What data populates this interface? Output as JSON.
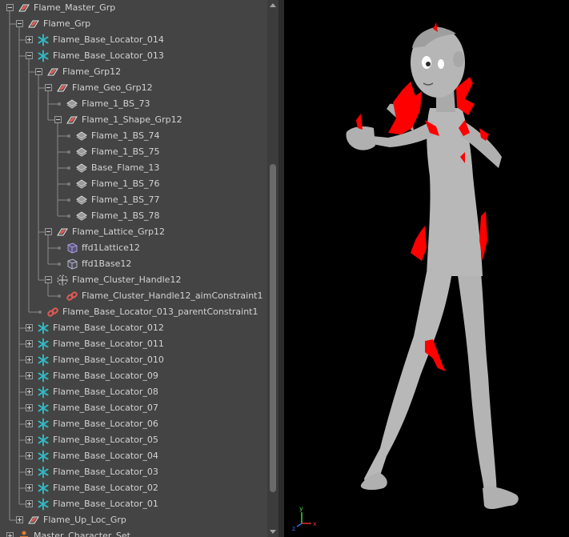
{
  "outliner": {
    "items": [
      {
        "label": "Flame_Master_Grp",
        "depth": 0,
        "node": "expanded",
        "icon": "transform-group-icon"
      },
      {
        "label": "Flame_Grp",
        "depth": 1,
        "node": "expanded",
        "icon": "transform-group-icon"
      },
      {
        "label": "Flame_Base_Locator_014",
        "depth": 2,
        "node": "collapsed",
        "icon": "locator-icon"
      },
      {
        "label": "Flame_Base_Locator_013",
        "depth": 2,
        "node": "expanded",
        "icon": "locator-icon"
      },
      {
        "label": "Flame_Grp12",
        "depth": 3,
        "node": "expanded",
        "icon": "transform-group-icon"
      },
      {
        "label": "Flame_Geo_Grp12",
        "depth": 4,
        "node": "expanded",
        "icon": "transform-group-icon"
      },
      {
        "label": "Flame_1_BS_73",
        "depth": 5,
        "node": "leaf",
        "icon": "mesh-icon"
      },
      {
        "label": "Flame_1_Shape_Grp12",
        "depth": 5,
        "node": "expanded",
        "icon": "transform-group-icon"
      },
      {
        "label": "Flame_1_BS_74",
        "depth": 6,
        "node": "leaf",
        "icon": "mesh-icon"
      },
      {
        "label": "Flame_1_BS_75",
        "depth": 6,
        "node": "leaf",
        "icon": "mesh-icon"
      },
      {
        "label": "Base_Flame_13",
        "depth": 6,
        "node": "leaf",
        "icon": "mesh-icon"
      },
      {
        "label": "Flame_1_BS_76",
        "depth": 6,
        "node": "leaf",
        "icon": "mesh-icon"
      },
      {
        "label": "Flame_1_BS_77",
        "depth": 6,
        "node": "leaf",
        "icon": "mesh-icon"
      },
      {
        "label": "Flame_1_BS_78",
        "depth": 6,
        "node": "leaf",
        "icon": "mesh-icon"
      },
      {
        "label": "Flame_Lattice_Grp12",
        "depth": 4,
        "node": "expanded",
        "icon": "transform-group-icon"
      },
      {
        "label": "ffd1Lattice12",
        "depth": 5,
        "node": "leaf",
        "icon": "lattice-icon"
      },
      {
        "label": "ffd1Base12",
        "depth": 5,
        "node": "leaf",
        "icon": "lattice-base-icon"
      },
      {
        "label": "Flame_Cluster_Handle12",
        "depth": 4,
        "node": "expanded",
        "icon": "cluster-handle-icon"
      },
      {
        "label": "Flame_Cluster_Handle12_aimConstraint1",
        "depth": 5,
        "node": "leaf",
        "icon": "constraint-icon"
      },
      {
        "label": "Flame_Base_Locator_013_parentConstraint1",
        "depth": 3,
        "node": "leaf",
        "icon": "constraint-icon"
      },
      {
        "label": "Flame_Base_Locator_012",
        "depth": 2,
        "node": "collapsed",
        "icon": "locator-icon"
      },
      {
        "label": "Flame_Base_Locator_011",
        "depth": 2,
        "node": "collapsed",
        "icon": "locator-icon"
      },
      {
        "label": "Flame_Base_Locator_010",
        "depth": 2,
        "node": "collapsed",
        "icon": "locator-icon"
      },
      {
        "label": "Flame_Base_Locator_09",
        "depth": 2,
        "node": "collapsed",
        "icon": "locator-icon"
      },
      {
        "label": "Flame_Base_Locator_08",
        "depth": 2,
        "node": "collapsed",
        "icon": "locator-icon"
      },
      {
        "label": "Flame_Base_Locator_07",
        "depth": 2,
        "node": "collapsed",
        "icon": "locator-icon"
      },
      {
        "label": "Flame_Base_Locator_06",
        "depth": 2,
        "node": "collapsed",
        "icon": "locator-icon"
      },
      {
        "label": "Flame_Base_Locator_05",
        "depth": 2,
        "node": "collapsed",
        "icon": "locator-icon"
      },
      {
        "label": "Flame_Base_Locator_04",
        "depth": 2,
        "node": "collapsed",
        "icon": "locator-icon"
      },
      {
        "label": "Flame_Base_Locator_03",
        "depth": 2,
        "node": "collapsed",
        "icon": "locator-icon"
      },
      {
        "label": "Flame_Base_Locator_02",
        "depth": 2,
        "node": "collapsed",
        "icon": "locator-icon"
      },
      {
        "label": "Flame_Base_Locator_01",
        "depth": 2,
        "node": "collapsed",
        "icon": "locator-icon"
      },
      {
        "label": "Flame_Up_Loc_Grp",
        "depth": 1,
        "node": "collapsed",
        "icon": "transform-group-icon"
      },
      {
        "label": "Master_Character_Set",
        "depth": 0,
        "node": "collapsed",
        "icon": "character-set-icon"
      }
    ]
  },
  "viewport": {
    "axis_labels": {
      "x": "x",
      "y": "y",
      "z": "z"
    }
  },
  "colors": {
    "outliner_bg": "#444444",
    "text": "#d2d2d2",
    "locator": "#2fb7c0",
    "group_red": "#e05a55",
    "mesh": "#d8d8d8",
    "lattice": "#a9a0e8",
    "constraint": "#e05a55",
    "flame": "#ff0000",
    "body": "#b4b4b4"
  }
}
